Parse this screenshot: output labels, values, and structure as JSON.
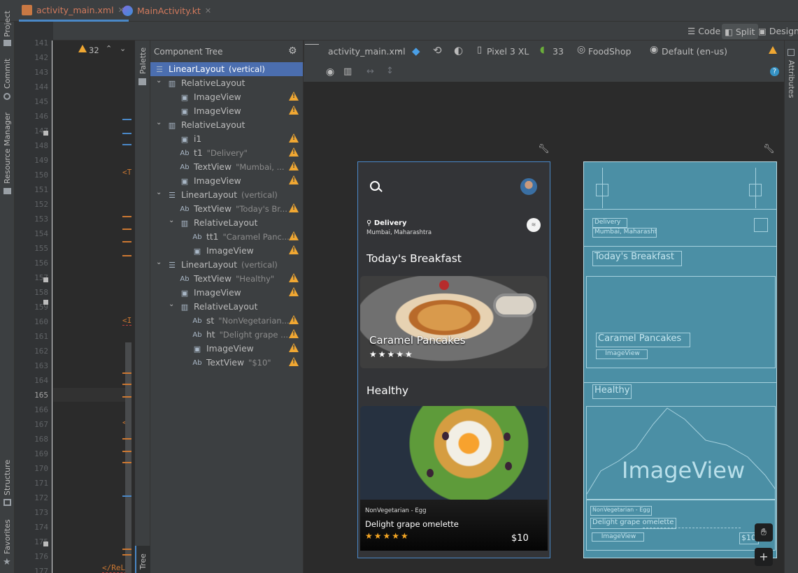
{
  "tabs": [
    {
      "label": "activity_main.xml",
      "close": "✕"
    },
    {
      "label": "MainActivity.kt",
      "close": "✕"
    }
  ],
  "view_modes": {
    "code": "Code",
    "split": "Split",
    "design": "Design"
  },
  "left_strip": {
    "project": "Project",
    "commit": "Commit",
    "resource_manager": "Resource Manager",
    "structure": "Structure",
    "favorites": "Favorites"
  },
  "right_strip": {
    "attributes": "Attributes"
  },
  "palette_label": "Palette",
  "tree_tab_label": "Tree",
  "editor": {
    "warning_count": "32",
    "line_numbers": [
      "141",
      "142",
      "143",
      "144",
      "145",
      "146",
      "147",
      "148",
      "149",
      "150",
      "151",
      "152",
      "153",
      "154",
      "155",
      "156",
      "157",
      "158",
      "159",
      "160",
      "161",
      "162",
      "163",
      "164",
      "165",
      "166",
      "167",
      "168",
      "169",
      "170",
      "171",
      "172",
      "173",
      "174",
      "175",
      "176",
      "177"
    ],
    "current_line": "165",
    "code_fragments": [
      "<T",
      "<I",
      "<T",
      "</ReLa"
    ]
  },
  "component_tree": {
    "title": "Component Tree",
    "nodes": [
      {
        "type": "LinearLayout",
        "meta": "(vertical)",
        "warn": false
      },
      {
        "type": "RelativeLayout",
        "meta": "",
        "warn": false
      },
      {
        "type": "ImageView",
        "meta": "",
        "warn": true
      },
      {
        "type": "ImageView",
        "meta": "",
        "warn": true
      },
      {
        "type": "RelativeLayout",
        "meta": "",
        "warn": false
      },
      {
        "type": "i1",
        "meta": "",
        "warn": true
      },
      {
        "type": "t1",
        "meta": "\"Delivery\"",
        "warn": true
      },
      {
        "type": "TextView",
        "meta": "\"Mumbai, ...",
        "warn": true
      },
      {
        "type": "ImageView",
        "meta": "",
        "warn": true
      },
      {
        "type": "LinearLayout",
        "meta": "(vertical)",
        "warn": false
      },
      {
        "type": "TextView",
        "meta": "\"Today's Br...",
        "warn": true
      },
      {
        "type": "RelativeLayout",
        "meta": "",
        "warn": false
      },
      {
        "type": "tt1",
        "meta": "\"Caramel Panc...",
        "warn": true
      },
      {
        "type": "ImageView",
        "meta": "",
        "warn": true
      },
      {
        "type": "LinearLayout",
        "meta": "(vertical)",
        "warn": false
      },
      {
        "type": "TextView",
        "meta": "\"Healthy\"",
        "warn": true
      },
      {
        "type": "ImageView",
        "meta": "",
        "warn": true
      },
      {
        "type": "RelativeLayout",
        "meta": "",
        "warn": false
      },
      {
        "type": "st",
        "meta": "\"NonVegetarian...",
        "warn": true
      },
      {
        "type": "ht",
        "meta": "\"Delight grape ...",
        "warn": true
      },
      {
        "type": "ImageView",
        "meta": "",
        "warn": true
      },
      {
        "type": "TextView",
        "meta": "\"$10\"",
        "warn": true
      }
    ]
  },
  "design_toolbar": {
    "file": "activity_main.xml",
    "device": "Pixel 3 XL",
    "api": "33",
    "theme": "FoodShop",
    "locale": "Default (en-us)"
  },
  "phone": {
    "delivery_label": "Delivery",
    "location": "Mumbai, Maharashtra",
    "section1_title": "Today's Breakfast",
    "card1_title": "Caramel Pancakes",
    "card1_stars": "★★★★★",
    "section2_title": "Healthy",
    "card2_category": "NonVegetarian - Egg",
    "card2_title": "Delight grape omelette",
    "card2_stars": "★★★★★",
    "card2_price": "$10"
  },
  "blueprint": {
    "delivery": "Delivery",
    "location": "Mumbai, Maharashtra",
    "section1": "Today's Breakfast",
    "card1_title": "Caramel Pancakes",
    "card1_image": "ImageView",
    "section2": "Healthy",
    "big_image": "ImageView",
    "card2_category": "NonVegetarian - Egg",
    "card2_title": "Delight grape omelette",
    "card2_image": "ImageView",
    "price": "$10"
  },
  "colors": {
    "accent_blue": "#4a88c7",
    "warning": "#f0a732",
    "blueprint": "#4b8fa5",
    "phone_bg": "#333437"
  }
}
